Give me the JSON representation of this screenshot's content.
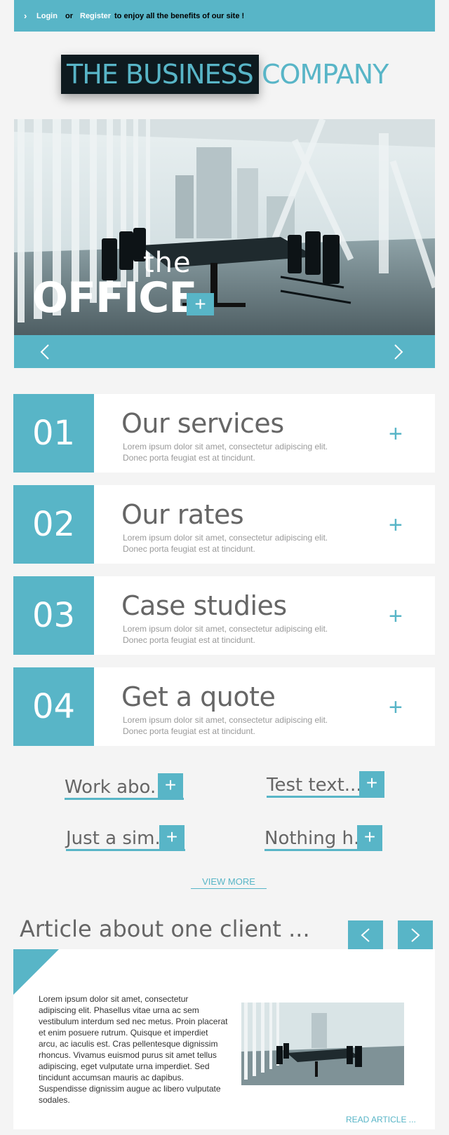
{
  "topbar": {
    "arrow": "›",
    "login": "Login",
    "or": "or",
    "register": "Register",
    "rest": "to enjoy all the benefits of our site !"
  },
  "logo": {
    "dark": "THE BUSINESS",
    "light": "COMPANY"
  },
  "hero": {
    "small": "the",
    "big": "OFFICE",
    "plus": "+",
    "prev": "‹",
    "next": "›"
  },
  "services": [
    {
      "num": "01",
      "title": "Our services",
      "desc": "Lorem ipsum dolor sit amet, consectetur adipiscing elit. Donec porta feugiat est at tincidunt.",
      "plus": "+"
    },
    {
      "num": "02",
      "title": "Our rates",
      "desc": "Lorem ipsum dolor sit amet, consectetur adipiscing elit. Donec porta feugiat est at tincidunt.",
      "plus": "+"
    },
    {
      "num": "03",
      "title": "Case studies",
      "desc": "Lorem ipsum dolor sit amet, consectetur adipiscing elit. Donec porta feugiat est at tincidunt.",
      "plus": "+"
    },
    {
      "num": "04",
      "title": "Get a quote",
      "desc": "Lorem ipsum dolor sit amet, consectetur adipiscing elit. Donec porta feugiat est at tincidunt.",
      "plus": "+"
    }
  ],
  "links": [
    {
      "label": "Work abo...",
      "plus": "+"
    },
    {
      "label": "Test text...",
      "plus": "+"
    },
    {
      "label": "Just a sim...",
      "plus": "+"
    },
    {
      "label": "Nothing h...",
      "plus": "+"
    }
  ],
  "view_more": "VIEW MORE",
  "article": {
    "heading": "Article about one client ...",
    "prev": "‹",
    "next": "›",
    "text": "Lorem ipsum dolor sit amet, consectetur adipiscing elit. Phasellus vitae urna ac sem vestibulum interdum sed nec metus. Proin placerat et enim posuere rutrum. Quisque et imperdiet arcu, ac iaculis est. Cras pellentesque dignissim rhoncus. Vivamus euismod purus sit amet tellus adipiscing, eget vulputate urna imperdiet. Sed tincidunt accumsan mauris ac dapibus. Suspendisse dignissim augue ac libero vulputate sodales.",
    "read": "READ ARTICLE ..."
  },
  "colors": {
    "accent": "#58b5c7",
    "background": "#f4f4f4",
    "logo_dark": "#0e1a1f"
  }
}
